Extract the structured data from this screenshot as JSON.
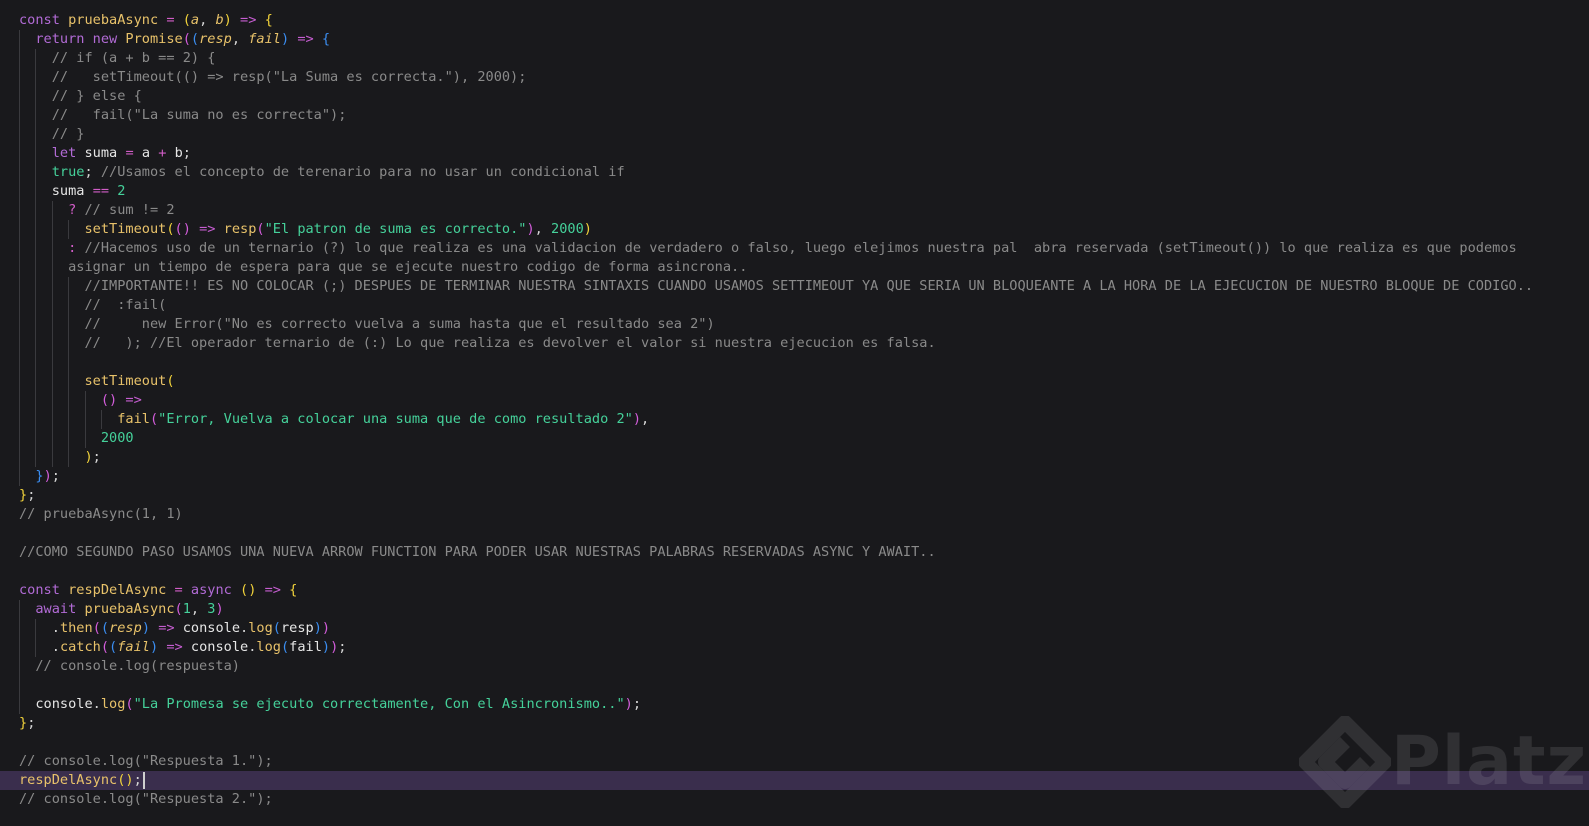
{
  "editor": {
    "lines": [
      {
        "t": [
          [
            "kw",
            "const "
          ],
          [
            "fn",
            "pruebaAsync"
          ],
          [
            "pl",
            " "
          ],
          [
            "op",
            "="
          ],
          [
            "pl",
            " "
          ],
          [
            "br1",
            "("
          ],
          [
            "param",
            "a"
          ],
          [
            "pun",
            ", "
          ],
          [
            "param",
            "b"
          ],
          [
            "br1",
            ")"
          ],
          [
            "pl",
            " "
          ],
          [
            "arrow",
            "=>"
          ],
          [
            "pl",
            " "
          ],
          [
            "br1",
            "{"
          ]
        ]
      },
      {
        "t": [
          [
            "pl",
            "  "
          ],
          [
            "kw",
            "return "
          ],
          [
            "kw",
            "new "
          ],
          [
            "fn",
            "Promise"
          ],
          [
            "br2",
            "("
          ],
          [
            "br3",
            "("
          ],
          [
            "param",
            "resp"
          ],
          [
            "pun",
            ", "
          ],
          [
            "param",
            "fail"
          ],
          [
            "br3",
            ")"
          ],
          [
            "pl",
            " "
          ],
          [
            "arrow",
            "=>"
          ],
          [
            "pl",
            " "
          ],
          [
            "br3",
            "{"
          ]
        ]
      },
      {
        "t": [
          [
            "pl",
            "    "
          ],
          [
            "cm",
            "// if (a + b == 2) {"
          ]
        ]
      },
      {
        "t": [
          [
            "pl",
            "    "
          ],
          [
            "cm",
            "//   setTimeout(() => resp(\"La Suma es correcta.\"), 2000);"
          ]
        ]
      },
      {
        "t": [
          [
            "pl",
            "    "
          ],
          [
            "cm",
            "// } else {"
          ]
        ]
      },
      {
        "t": [
          [
            "pl",
            "    "
          ],
          [
            "cm",
            "//   fail(\"La suma no es correcta\");"
          ]
        ]
      },
      {
        "t": [
          [
            "pl",
            "    "
          ],
          [
            "cm",
            "// }"
          ]
        ]
      },
      {
        "t": [
          [
            "pl",
            "    "
          ],
          [
            "kw",
            "let "
          ],
          [
            "id",
            "suma"
          ],
          [
            "pl",
            " "
          ],
          [
            "op",
            "="
          ],
          [
            "pl",
            " "
          ],
          [
            "id",
            "a"
          ],
          [
            "pl",
            " "
          ],
          [
            "op",
            "+"
          ],
          [
            "pl",
            " "
          ],
          [
            "id",
            "b"
          ],
          [
            "pun",
            ";"
          ]
        ]
      },
      {
        "t": [
          [
            "pl",
            "    "
          ],
          [
            "str",
            "true"
          ],
          [
            "pun",
            "; "
          ],
          [
            "cm",
            "//Usamos el concepto de terenario para no usar un condicional if"
          ]
        ]
      },
      {
        "t": [
          [
            "pl",
            "    "
          ],
          [
            "id",
            "suma"
          ],
          [
            "pl",
            " "
          ],
          [
            "op",
            "=="
          ],
          [
            "pl",
            " "
          ],
          [
            "num",
            "2"
          ]
        ]
      },
      {
        "t": [
          [
            "pl",
            "      "
          ],
          [
            "op",
            "?"
          ],
          [
            "pl",
            " "
          ],
          [
            "cm",
            "// sum != 2"
          ]
        ]
      },
      {
        "t": [
          [
            "pl",
            "        "
          ],
          [
            "fn",
            "setTimeout"
          ],
          [
            "br1",
            "("
          ],
          [
            "br2",
            "("
          ],
          [
            "br2",
            ")"
          ],
          [
            "pl",
            " "
          ],
          [
            "arrow",
            "=>"
          ],
          [
            "pl",
            " "
          ],
          [
            "fn",
            "resp"
          ],
          [
            "br2",
            "("
          ],
          [
            "str",
            "\"El patron de suma es correcto.\""
          ],
          [
            "br2",
            ")"
          ],
          [
            "pun",
            ", "
          ],
          [
            "num",
            "2000"
          ],
          [
            "br1",
            ")"
          ]
        ]
      },
      {
        "t": [
          [
            "pl",
            "      "
          ],
          [
            "op",
            ":"
          ],
          [
            "pl",
            " "
          ],
          [
            "cm",
            "//Hacemos uso de un ternario (?) lo que realiza es una validacion de verdadero o falso, luego elejimos nuestra pal  abra reservada (setTimeout()) lo que realiza es que podemos"
          ]
        ]
      },
      {
        "t": [
          [
            "pl",
            "      "
          ],
          [
            "cm",
            "asignar un tiempo de espera para que se ejecute nuestro codigo de forma asincrona.."
          ]
        ]
      },
      {
        "t": [
          [
            "pl",
            "        "
          ],
          [
            "cm",
            "//IMPORTANTE!! ES NO COLOCAR (;) DESPUES DE TERMINAR NUESTRA SINTAXIS CUANDO USAMOS SETTIMEOUT YA QUE SERIA UN BLOQUEANTE A LA HORA DE LA EJECUCION DE NUESTRO BLOQUE DE CODIGO.."
          ]
        ]
      },
      {
        "t": [
          [
            "pl",
            "        "
          ],
          [
            "cm",
            "//  :fail("
          ]
        ]
      },
      {
        "t": [
          [
            "pl",
            "        "
          ],
          [
            "cm",
            "//     new Error(\"No es correcto vuelva a suma hasta que el resultado sea 2\")"
          ]
        ]
      },
      {
        "t": [
          [
            "pl",
            "        "
          ],
          [
            "cm",
            "//   ); //El operador ternario de (:) Lo que realiza es devolver el valor si nuestra ejecucion es falsa."
          ]
        ]
      },
      {
        "t": [
          [
            "pl",
            ""
          ]
        ]
      },
      {
        "t": [
          [
            "pl",
            "        "
          ],
          [
            "fn",
            "setTimeout"
          ],
          [
            "br1",
            "("
          ]
        ]
      },
      {
        "t": [
          [
            "pl",
            "          "
          ],
          [
            "br2",
            "("
          ],
          [
            "br2",
            ")"
          ],
          [
            "pl",
            " "
          ],
          [
            "arrow",
            "=>"
          ]
        ]
      },
      {
        "t": [
          [
            "pl",
            "            "
          ],
          [
            "fn",
            "fail"
          ],
          [
            "br2",
            "("
          ],
          [
            "str",
            "\"Error, Vuelva a colocar una suma que de como resultado 2\""
          ],
          [
            "br2",
            ")"
          ],
          [
            "pun",
            ","
          ]
        ]
      },
      {
        "t": [
          [
            "pl",
            "          "
          ],
          [
            "num",
            "2000"
          ]
        ]
      },
      {
        "t": [
          [
            "pl",
            "        "
          ],
          [
            "br1",
            ")"
          ],
          [
            "pun",
            ";"
          ]
        ]
      },
      {
        "t": [
          [
            "pl",
            "  "
          ],
          [
            "br3",
            "}"
          ],
          [
            "br2",
            ")"
          ],
          [
            "pun",
            ";"
          ]
        ]
      },
      {
        "t": [
          [
            "br1",
            "}"
          ],
          [
            "pun",
            ";"
          ]
        ]
      },
      {
        "t": [
          [
            "cm",
            "// pruebaAsync(1, 1)"
          ]
        ]
      },
      {
        "t": [
          [
            "pl",
            ""
          ]
        ]
      },
      {
        "t": [
          [
            "cm",
            "//COMO SEGUNDO PASO USAMOS UNA NUEVA ARROW FUNCTION PARA PODER USAR NUESTRAS PALABRAS RESERVADAS ASYNC Y AWAIT.."
          ]
        ]
      },
      {
        "t": [
          [
            "pl",
            ""
          ]
        ]
      },
      {
        "t": [
          [
            "kw",
            "const "
          ],
          [
            "fn",
            "respDelAsync"
          ],
          [
            "pl",
            " "
          ],
          [
            "op",
            "="
          ],
          [
            "pl",
            " "
          ],
          [
            "kw",
            "async "
          ],
          [
            "br1",
            "("
          ],
          [
            "br1",
            ")"
          ],
          [
            "pl",
            " "
          ],
          [
            "arrow",
            "=>"
          ],
          [
            "pl",
            " "
          ],
          [
            "br1",
            "{"
          ]
        ]
      },
      {
        "t": [
          [
            "pl",
            "  "
          ],
          [
            "kw",
            "await "
          ],
          [
            "fn",
            "pruebaAsync"
          ],
          [
            "br2",
            "("
          ],
          [
            "num",
            "1"
          ],
          [
            "pun",
            ", "
          ],
          [
            "num",
            "3"
          ],
          [
            "br2",
            ")"
          ]
        ]
      },
      {
        "t": [
          [
            "pl",
            "    "
          ],
          [
            "pun",
            "."
          ],
          [
            "fn",
            "then"
          ],
          [
            "br2",
            "("
          ],
          [
            "br3",
            "("
          ],
          [
            "param",
            "resp"
          ],
          [
            "br3",
            ")"
          ],
          [
            "pl",
            " "
          ],
          [
            "arrow",
            "=>"
          ],
          [
            "pl",
            " "
          ],
          [
            "id",
            "console"
          ],
          [
            "pun",
            "."
          ],
          [
            "fn",
            "log"
          ],
          [
            "br3",
            "("
          ],
          [
            "id",
            "resp"
          ],
          [
            "br3",
            ")"
          ],
          [
            "br2",
            ")"
          ]
        ]
      },
      {
        "t": [
          [
            "pl",
            "    "
          ],
          [
            "pun",
            "."
          ],
          [
            "fn",
            "catch"
          ],
          [
            "br2",
            "("
          ],
          [
            "br3",
            "("
          ],
          [
            "param",
            "fail"
          ],
          [
            "br3",
            ")"
          ],
          [
            "pl",
            " "
          ],
          [
            "arrow",
            "=>"
          ],
          [
            "pl",
            " "
          ],
          [
            "id",
            "console"
          ],
          [
            "pun",
            "."
          ],
          [
            "fn",
            "log"
          ],
          [
            "br3",
            "("
          ],
          [
            "id",
            "fail"
          ],
          [
            "br3",
            ")"
          ],
          [
            "br2",
            ")"
          ],
          [
            "pun",
            ";"
          ]
        ]
      },
      {
        "t": [
          [
            "pl",
            "  "
          ],
          [
            "cm",
            "// console.log(respuesta)"
          ]
        ]
      },
      {
        "t": [
          [
            "pl",
            ""
          ]
        ]
      },
      {
        "t": [
          [
            "pl",
            "  "
          ],
          [
            "id",
            "console"
          ],
          [
            "pun",
            "."
          ],
          [
            "fn",
            "log"
          ],
          [
            "br2",
            "("
          ],
          [
            "str",
            "\"La Promesa se ejecuto correctamente, Con el Asincronismo..\""
          ],
          [
            "br2",
            ")"
          ],
          [
            "pun",
            ";"
          ]
        ]
      },
      {
        "t": [
          [
            "br1",
            "}"
          ],
          [
            "pun",
            ";"
          ]
        ]
      },
      {
        "t": [
          [
            "pl",
            ""
          ]
        ]
      },
      {
        "t": [
          [
            "cm",
            "// console.log(\"Respuesta 1.\");"
          ]
        ]
      },
      {
        "t": [
          [
            "fn",
            "respDelAsync"
          ],
          [
            "br1",
            "("
          ],
          [
            "br1",
            ")"
          ],
          [
            "pun",
            ";"
          ]
        ],
        "active": true
      },
      {
        "t": [
          [
            "cm",
            "// console.log(\"Respuesta 2.\");"
          ]
        ]
      }
    ],
    "guides": [
      {
        "from": 1,
        "to": 24,
        "col": 0
      },
      {
        "from": 2,
        "to": 23,
        "col": 2
      },
      {
        "from": 10,
        "to": 23,
        "col": 4
      },
      {
        "from": 11,
        "to": 11,
        "col": 6
      },
      {
        "from": 14,
        "to": 23,
        "col": 6
      },
      {
        "from": 20,
        "to": 22,
        "col": 8
      },
      {
        "from": 21,
        "to": 21,
        "col": 10
      },
      {
        "from": 31,
        "to": 36,
        "col": 0
      },
      {
        "from": 32,
        "to": 33,
        "col": 2
      }
    ]
  },
  "watermark": {
    "brand": "Platzi"
  }
}
